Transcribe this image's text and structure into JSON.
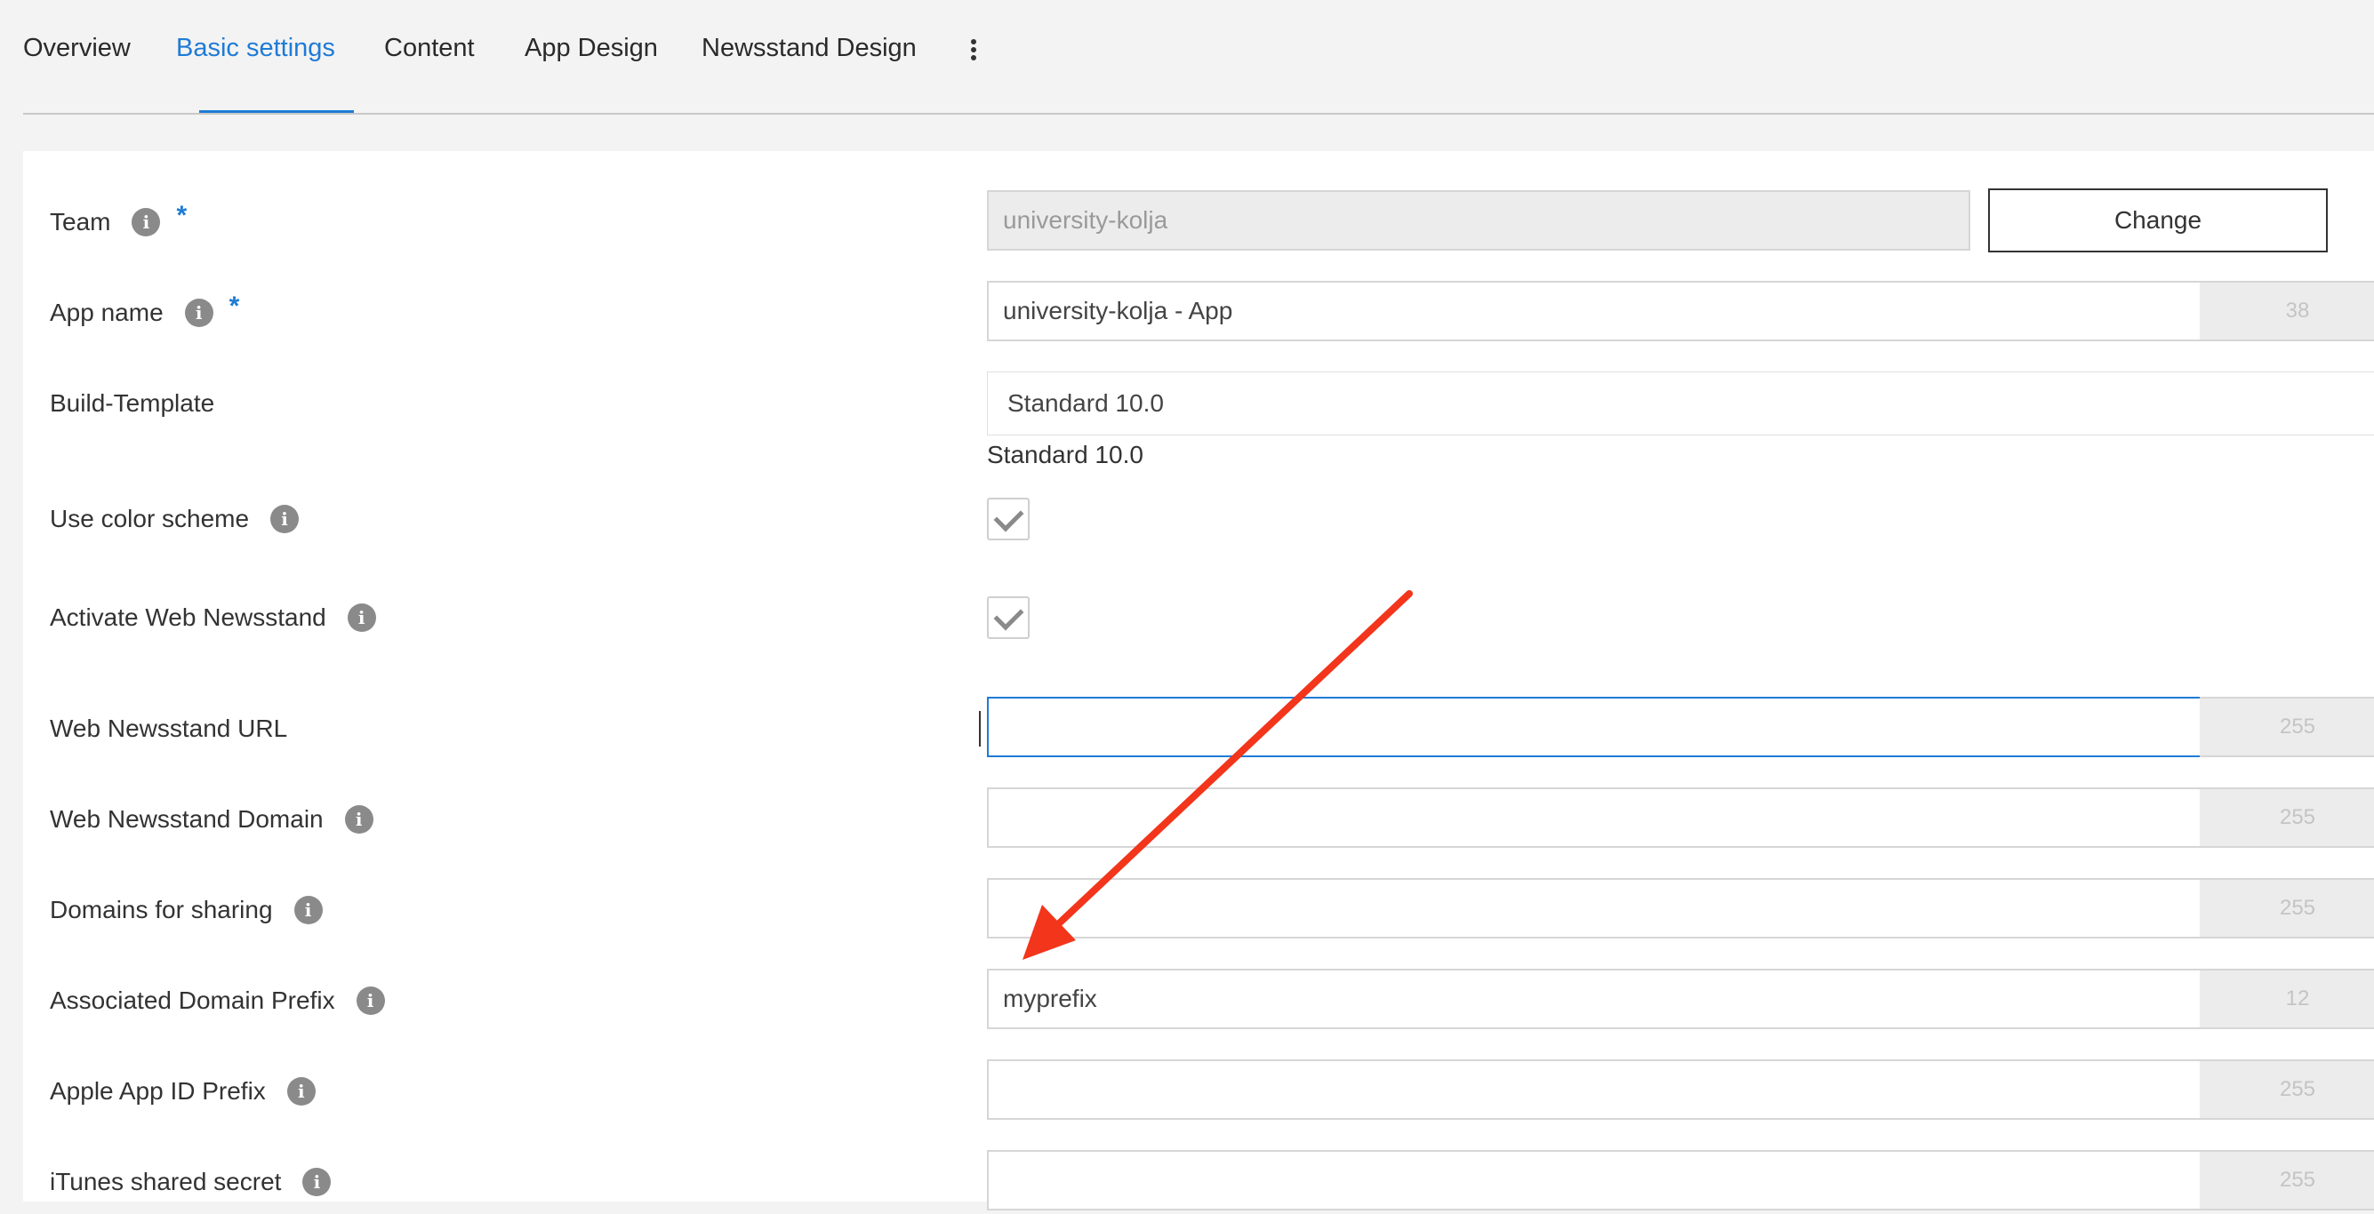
{
  "tabs": [
    {
      "label": "Overview",
      "active": false
    },
    {
      "label": "Basic settings",
      "active": true
    },
    {
      "label": "Content",
      "active": false
    },
    {
      "label": "App Design",
      "active": false
    },
    {
      "label": "Newsstand Design",
      "active": false
    }
  ],
  "more_menu_icon": "kebab-vertical-icon",
  "form": {
    "team": {
      "label": "Team",
      "required_mark": "*",
      "value": "university-kolja",
      "change_label": "Change"
    },
    "app_name": {
      "label": "App name",
      "required_mark": "*",
      "value": "university-kolja - App",
      "counter": "38"
    },
    "build_template": {
      "label": "Build-Template",
      "selected": "Standard 10.0",
      "caption": "Standard 10.0"
    },
    "use_color_scheme": {
      "label": "Use color scheme",
      "checked": true
    },
    "activate_web_newsstand": {
      "label": "Activate Web Newsstand",
      "checked": true
    },
    "web_newsstand_url": {
      "label": "Web Newsstand URL",
      "value": "",
      "counter": "255"
    },
    "web_newsstand_domain": {
      "label": "Web Newsstand Domain",
      "value": "",
      "counter": "255"
    },
    "domains_for_sharing": {
      "label": "Domains for sharing",
      "value": "",
      "counter": "255"
    },
    "associated_domain_prefix": {
      "label": "Associated Domain Prefix",
      "value": "myprefix",
      "counter": "12"
    },
    "apple_app_id_prefix": {
      "label": "Apple App ID Prefix",
      "value": "",
      "counter": "255"
    },
    "itunes_shared_secret": {
      "label": "iTunes shared secret",
      "value": "",
      "counter": "255"
    }
  },
  "annotation": {
    "arrow_color": "#f2351b"
  },
  "colors": {
    "accent": "#1e7bd6",
    "info_icon": "#8a8a8a"
  }
}
